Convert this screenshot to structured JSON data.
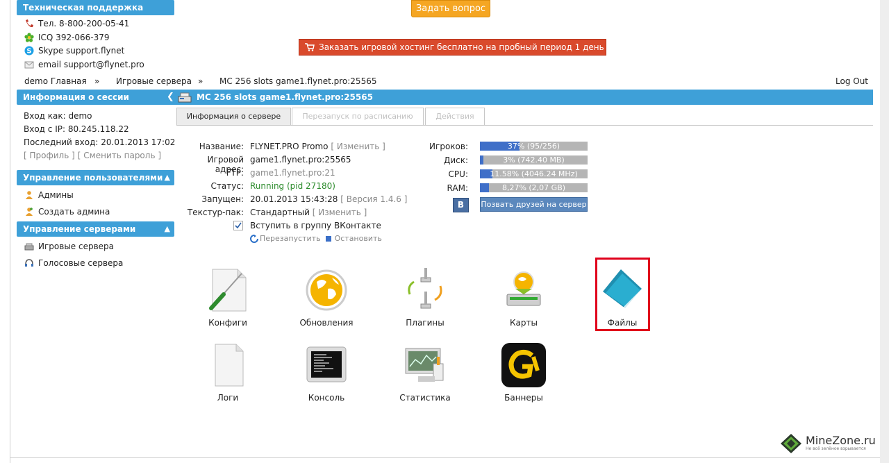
{
  "support": {
    "title": "Техническая поддержка",
    "phone": "Тел. 8-800-200-05-41",
    "icq": "ICQ 392-066-379",
    "skype": "Skype support.flynet",
    "email": "email support@flynet.pro"
  },
  "top_buttons": {
    "ask": "Задать вопрос",
    "order": "Заказать игровой хостинг бесплатно на пробный период 1 день"
  },
  "breadcrumbs": {
    "home": "demo Главная",
    "sep1": "»",
    "servers": "Игровые сервера",
    "sep2": "»",
    "current": "MC 256 slots game1.flynet.pro:25565",
    "logout": "Log Out"
  },
  "session": {
    "title": "Информация о сессии",
    "login_as": "Вход как: demo",
    "login_ip": "Вход с IP: 80.245.118.22",
    "last_login": "Последний вход: 20.01.2013 17:02",
    "profile_link": "[ Профиль ]",
    "change_pass_link": "[ Сменить пароль ]"
  },
  "users_panel": {
    "title": "Управление пользователями",
    "admins": "Админы",
    "create_admin": "Создать админа"
  },
  "servers_panel": {
    "title": "Управление серверами",
    "game_servers": "Игровые сервера",
    "voice_servers": "Голосовые сервера"
  },
  "main": {
    "title": "MC 256 slots game1.flynet.pro:25565",
    "tabs": [
      "Информация о сервере",
      "Перезапуск по расписанию",
      "Действия"
    ]
  },
  "server_info": {
    "name_label": "Название:",
    "name_value": "FLYNET.PRO Promo",
    "name_edit": "[ Изменить ]",
    "address_label": "Игровой адрес:",
    "address_value": "game1.flynet.pro:25565",
    "ftp_label": "FTP:",
    "ftp_value": "game1.flynet.pro:21",
    "status_label": "Статус:",
    "status_value": "Running (pid 27180)",
    "started_label": "Запущен:",
    "started_value": "20.01.2013 15:43:28",
    "version": "[ Версия 1.4.6 ]",
    "texture_label": "Текстур-пак:",
    "texture_value": "Стандартный",
    "texture_edit": "[ Изменить ]",
    "vk_join": "Вступить в группу ВКонтакте",
    "restart": "Перезапустить",
    "stop": "Остановить"
  },
  "stats": {
    "players": {
      "label": "Игроков:",
      "text": "37% (95/256)",
      "percent": 37
    },
    "disk": {
      "label": "Диск:",
      "text": "3% (742.40 MB)",
      "percent": 3
    },
    "cpu": {
      "label": "CPU:",
      "text": "11.58% (4046.24 MHz)",
      "percent": 11.58
    },
    "ram": {
      "label": "RAM:",
      "text": "8,27% (2,07 GB)",
      "percent": 8.27
    },
    "vk_letter": "B",
    "invite": "Позвать друзей на сервер"
  },
  "tiles": {
    "configs": "Конфиги",
    "updates": "Обновления",
    "plugins": "Плагины",
    "maps": "Карты",
    "files": "Файлы",
    "logs": "Логи",
    "console": "Консоль",
    "statistics": "Статистика",
    "banners": "Баннеры"
  },
  "watermark": {
    "title": "MineZone.ru",
    "sub": "Не всё зелёное взрывается"
  },
  "colors": {
    "accent": "#3ea0d8",
    "orange": "#f5a623",
    "red": "#d94a2c",
    "bar_fill": "#3f6fc8",
    "highlight": "#e0001b"
  }
}
